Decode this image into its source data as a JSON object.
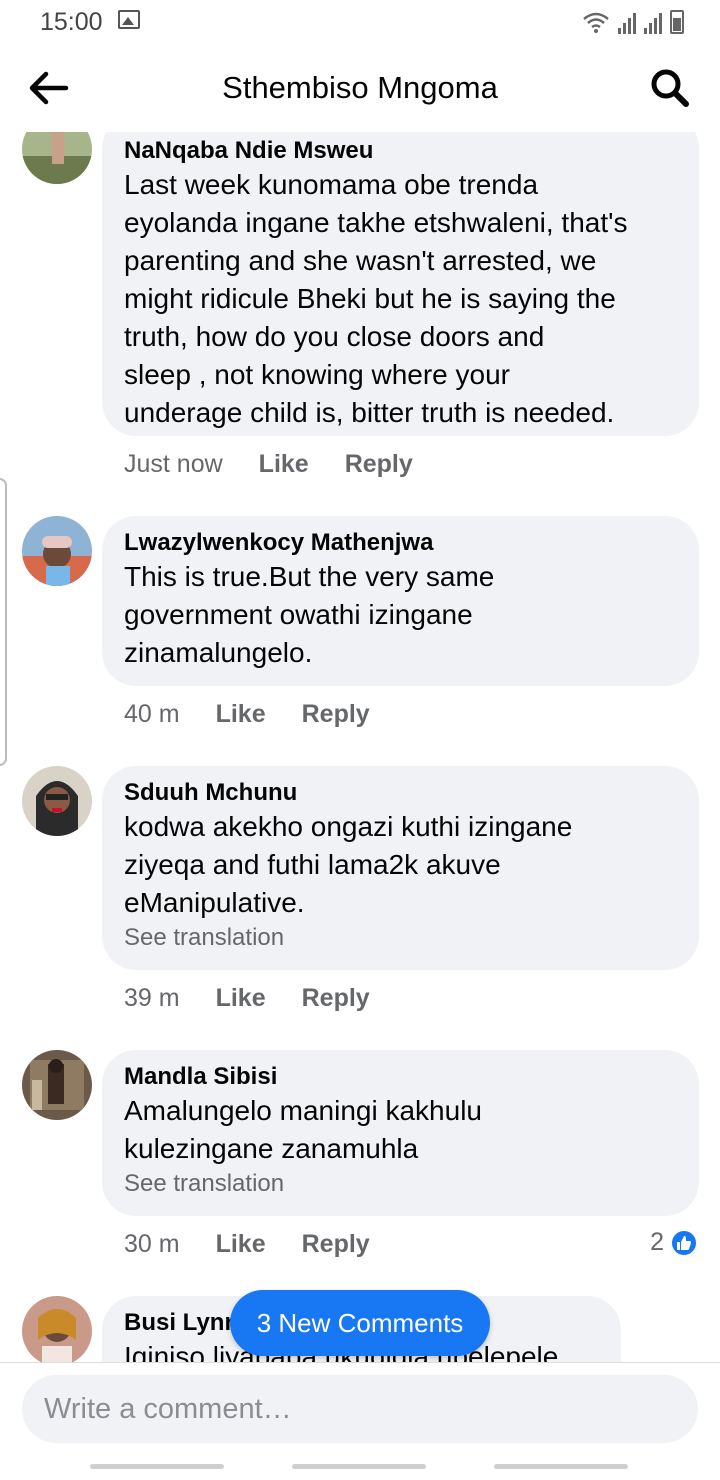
{
  "status_bar": {
    "time": "15:00"
  },
  "header": {
    "title": "Sthembiso Mngoma"
  },
  "comments": [
    {
      "author": "NaNqaba Ndie Msweu",
      "lines": [
        "Last week  kunomama obe trenda",
        "eyolanda ingane takhe etshwaleni, that's",
        "parenting  and she wasn't  arrested,  we",
        "might ridicule Bheki but he is saying the",
        "truth, how do you close doors and",
        "sleep  , not knowing  where your",
        "underage  child is, bitter truth is needed."
      ],
      "time": "Just now",
      "like": "Like",
      "reply": "Reply"
    },
    {
      "author": "Lwazylwenkocy Mathenjwa",
      "lines": [
        "This is true.But the very same",
        "government  owathi izingane",
        "zinamalungelo."
      ],
      "time": "40 m",
      "like": "Like",
      "reply": "Reply"
    },
    {
      "author": "Sduuh Mchunu",
      "lines": [
        "kodwa akekho ongazi kuthi izingane",
        "ziyeqa and futhi lama2k akuve",
        "eManipulative."
      ],
      "see_translation": "See translation",
      "time": "39 m",
      "like": "Like",
      "reply": "Reply"
    },
    {
      "author": "Mandla Sibisi",
      "lines": [
        "Amalungelo maningi kakhulu",
        "kulezingane zanamuhla"
      ],
      "see_translation": "See translation",
      "time": "30 m",
      "like": "Like",
      "reply": "Reply",
      "reaction_count": "2"
    },
    {
      "author": "Busi Lynn",
      "lines": [
        "Iqiniso liyapapa ukuqiqla upelepele"
      ]
    }
  ],
  "new_comments_pill": "3 New Comments",
  "composer": {
    "placeholder": "Write a comment…"
  },
  "colors": {
    "accent": "#1877f2",
    "bubble": "#f0f2f5",
    "muted": "#65676b"
  }
}
